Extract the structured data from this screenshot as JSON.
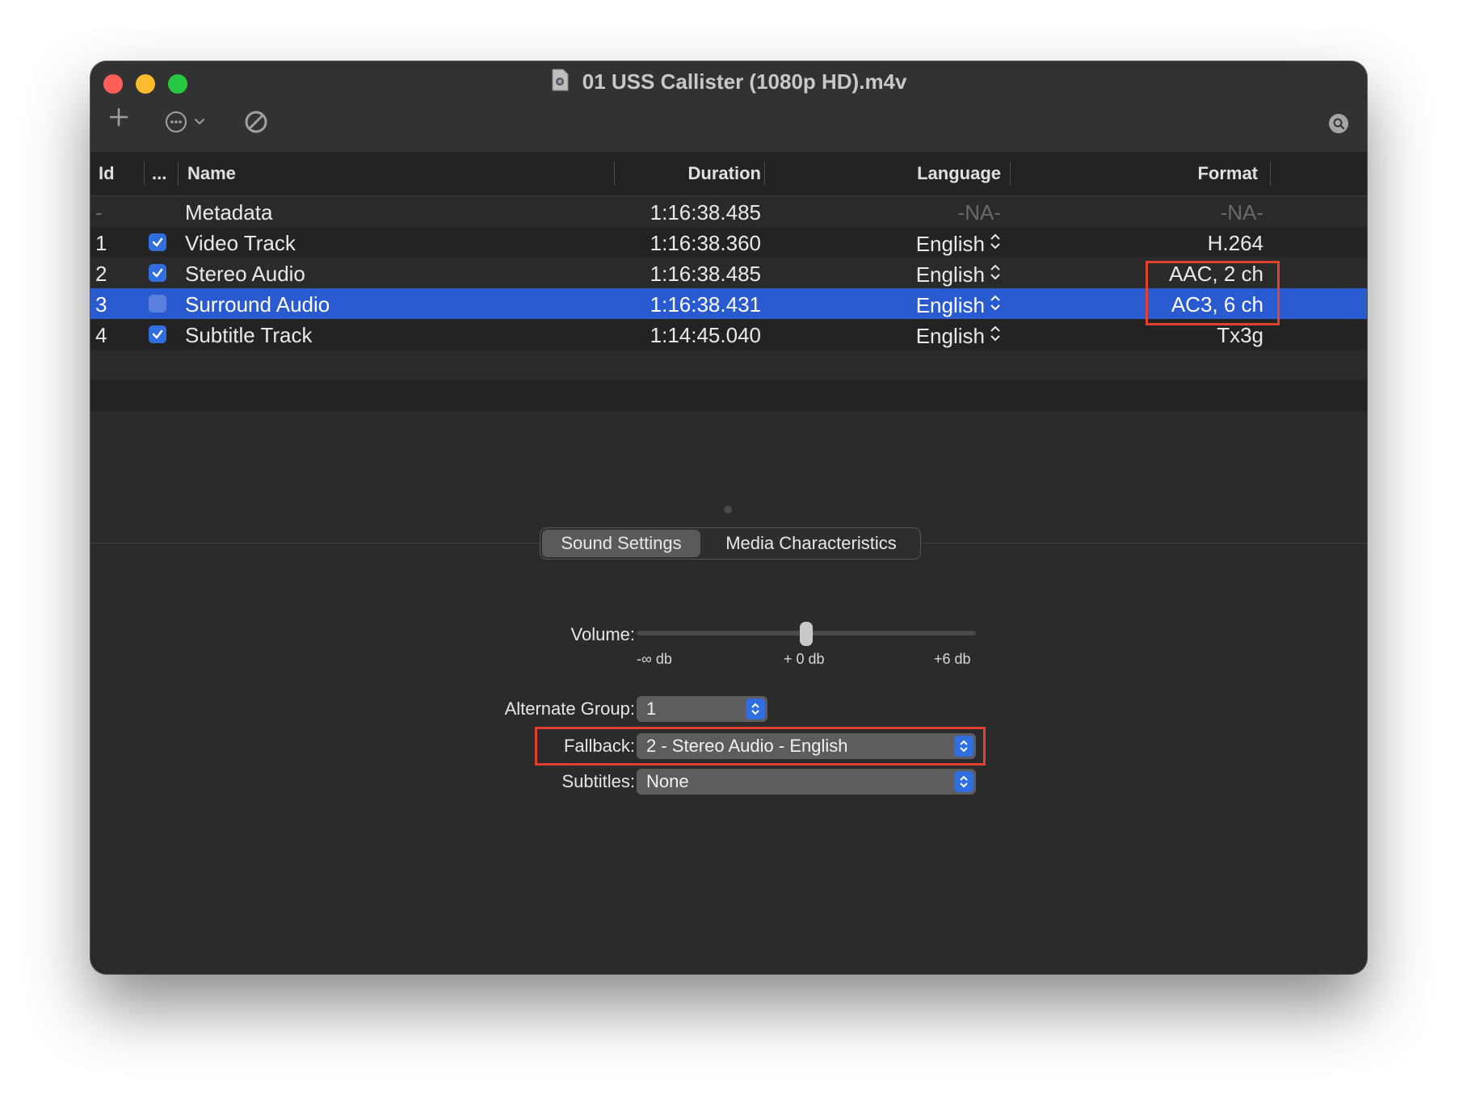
{
  "window": {
    "title": "01 USS Callister (1080p HD).m4v"
  },
  "toolbar": {
    "add_icon": "plus-icon",
    "more_icon": "ellipsis-circle-icon",
    "cancel_icon": "prohibited-icon",
    "search_icon": "search-icon"
  },
  "table": {
    "columns": {
      "id": "Id",
      "enabled": "...",
      "name": "Name",
      "duration": "Duration",
      "language": "Language",
      "format": "Format"
    },
    "rows": [
      {
        "id": "-",
        "checked": null,
        "name": "Metadata",
        "duration": "1:16:38.485",
        "language": "-NA-",
        "format": "-NA-"
      },
      {
        "id": "1",
        "checked": true,
        "name": "Video Track",
        "duration": "1:16:38.360",
        "language": "English",
        "format": "H.264"
      },
      {
        "id": "2",
        "checked": true,
        "name": "Stereo Audio",
        "duration": "1:16:38.485",
        "language": "English",
        "format": "AAC, 2 ch"
      },
      {
        "id": "3",
        "checked": false,
        "name": "Surround Audio",
        "duration": "1:16:38.431",
        "language": "English",
        "format": "AC3, 6 ch",
        "selected": true
      },
      {
        "id": "4",
        "checked": true,
        "name": "Subtitle Track",
        "duration": "1:14:45.040",
        "language": "English",
        "format": "Tx3g"
      }
    ]
  },
  "tabs": {
    "sound_settings": "Sound Settings",
    "media_characteristics": "Media Characteristics"
  },
  "sound": {
    "volume_label": "Volume:",
    "volume_ticks": [
      "-∞ db",
      "+ 0 db",
      "+6 db"
    ],
    "volume_level": 0.5,
    "alternate_group_label": "Alternate Group:",
    "alternate_group_value": "1",
    "fallback_label": "Fallback:",
    "fallback_value": "2 - Stereo Audio - English",
    "subtitles_label": "Subtitles:",
    "subtitles_value": "None"
  },
  "colors": {
    "selection": "#2a5ad0",
    "annotation": "#e3412f",
    "accent": "#2f6fe0"
  }
}
